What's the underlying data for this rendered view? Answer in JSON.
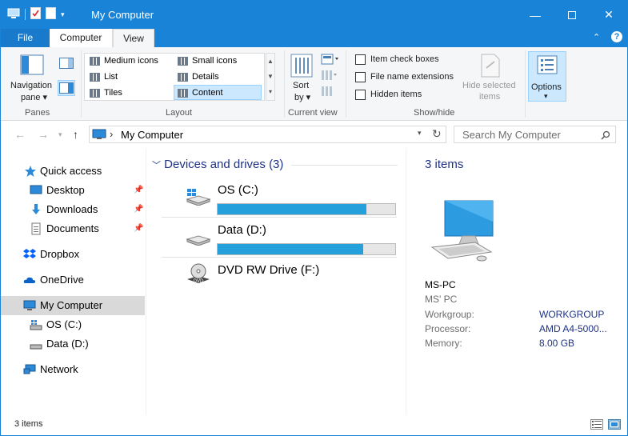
{
  "window": {
    "title": "My Computer"
  },
  "tabs": [
    {
      "label": "File"
    },
    {
      "label": "Computer"
    },
    {
      "label": "View"
    }
  ],
  "ribbon": {
    "panes": {
      "nav_pane_line1": "Navigation",
      "nav_pane_line2": "pane ▾",
      "group": "Panes"
    },
    "layout": {
      "items": [
        {
          "label": "Medium icons"
        },
        {
          "label": "Small icons"
        },
        {
          "label": "List"
        },
        {
          "label": "Details"
        },
        {
          "label": "Tiles"
        },
        {
          "label": "Content"
        }
      ],
      "selected": "Content",
      "group": "Layout"
    },
    "current_view": {
      "sort_line1": "Sort",
      "sort_line2": "by ▾",
      "group": "Current view"
    },
    "show_hide": {
      "item_check_boxes": "Item check boxes",
      "file_name_extensions": "File name extensions",
      "hidden_items": "Hidden items",
      "hide_selected_line1": "Hide selected",
      "hide_selected_line2": "items",
      "group": "Show/hide"
    },
    "options": {
      "label": "Options",
      "caret": "▾"
    }
  },
  "address": {
    "path_segment": "My Computer",
    "separator": "›"
  },
  "search": {
    "placeholder": "Search My Computer"
  },
  "sidebar": {
    "items": [
      {
        "label": "Quick access"
      },
      {
        "label": "Desktop"
      },
      {
        "label": "Downloads"
      },
      {
        "label": "Documents"
      },
      {
        "label": "Dropbox"
      },
      {
        "label": "OneDrive"
      },
      {
        "label": "My Computer"
      },
      {
        "label": "OS (C:)"
      },
      {
        "label": "Data (D:)"
      },
      {
        "label": "Network"
      }
    ]
  },
  "main": {
    "group_header": "Devices and drives (3)",
    "drives": [
      {
        "name": "OS (C:)",
        "used_fraction": 0.84
      },
      {
        "name": "Data (D:)",
        "used_fraction": 0.82
      },
      {
        "name": "DVD RW Drive (F:)"
      }
    ],
    "dvd_icon_label": "DVD"
  },
  "details": {
    "count": "3 items",
    "name": "MS-PC",
    "subtitle": "MS' PC",
    "props": [
      {
        "key": "Workgroup:",
        "value": "WORKGROUP"
      },
      {
        "key": "Processor:",
        "value": "AMD A4-5000..."
      },
      {
        "key": "Memory:",
        "value": "8.00 GB"
      }
    ]
  },
  "status": {
    "count": "3 items"
  },
  "colors": {
    "accent": "#1883d7",
    "progress": "#26a0da",
    "selection": "#cce8ff",
    "header_text": "#1e3287"
  }
}
